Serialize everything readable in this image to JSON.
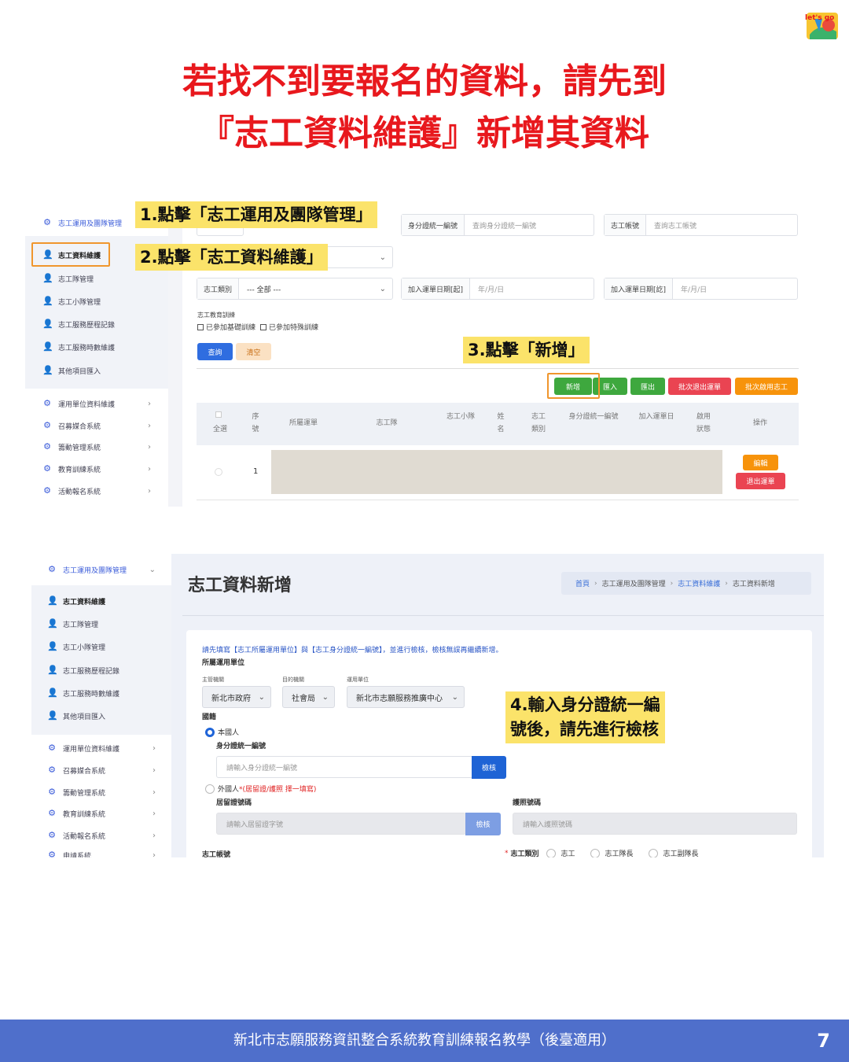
{
  "page": {
    "title_line1": "若找不到要報名的資料，請先到",
    "title_line2": "『志工資料維護』新增其資料",
    "footer_text": "新北市志願服務資訊整合系統教育訓練報名教學（後臺適用）",
    "page_number": "7",
    "logo_text": "let's go"
  },
  "colors": {
    "title": "#e8181d",
    "footer": "#4f6fcb",
    "callout": "#fbe36a",
    "highlight": "#f0962d"
  },
  "callouts": {
    "step1": "1.點擊「志工運用及團隊管理」",
    "step2": "2.點擊「志工資料維護」",
    "step3": "3.點擊「新增」",
    "step4_line1": "4.輸入身分證統一編",
    "step4_line2": "號後，請先進行檢核"
  },
  "shot1": {
    "sidebar": {
      "group": {
        "label": "志工運用及團隊管理",
        "icon": "gear-icon"
      },
      "subitems": [
        "志工資料維護",
        "志工隊管理",
        "志工小隊管理",
        "志工服務歷程記錄",
        "志工服務時數維護",
        "其他項目匯入"
      ],
      "modules": [
        "運用單位資料維護",
        "召募媒合系統",
        "籌動管理系統",
        "教育訓練系統",
        "活動報名系統"
      ]
    },
    "filters": {
      "id_label": "身分證統一編號",
      "id_placeholder": "查詢身分證統一編號",
      "account_label": "志工帳號",
      "account_placeholder": "查詢志工帳號",
      "type_label": "志工類別",
      "type_value": "--- 全部 ---",
      "join_start_label": "加入運單日期[起]",
      "join_start_placeholder": "年/月/日",
      "join_end_label": "加入運單日期[訖]",
      "join_end_placeholder": "年/月/日",
      "training_label": "志工教育訓練",
      "training_basic": "已參加基礎訓練",
      "training_special": "已參加特殊訓練"
    },
    "buttons": {
      "query": "查詢",
      "clear": "清空",
      "add": "新增",
      "import": "匯入",
      "export": "匯出",
      "batch_quit": "批次退出運單",
      "batch_enable": "批次啟用志工"
    },
    "table": {
      "headers": [
        "全選",
        "序號",
        "所屬運單",
        "志工隊",
        "志工小隊",
        "姓名",
        "志工類別",
        "身分證統一編號",
        "加入運單日",
        "啟用狀態",
        "操作"
      ],
      "rows": [
        {
          "seq": "1",
          "edit": "編輯",
          "quit": "退出運單"
        }
      ]
    }
  },
  "shot2": {
    "sidebar": {
      "group": "志工運用及團隊管理",
      "subitems": [
        "志工資料維護",
        "志工隊管理",
        "志工小隊管理",
        "志工服務歷程記錄",
        "志工服務時數維護",
        "其他項目匯入"
      ],
      "modules": [
        "運用單位資料維護",
        "召募媒合系統",
        "籌動管理系統",
        "教育訓練系統",
        "活動報名系統",
        "申請系統"
      ]
    },
    "header": {
      "title": "志工資料新增",
      "breadcrumb": [
        "首頁",
        "志工運用及團隊管理",
        "志工資料維護",
        "志工資料新增"
      ]
    },
    "form": {
      "notice": "請先填寫【志工所屬運用單位】與【志工身分證統一編號】，並進行檢核，檢核無誤再繼續新增。",
      "unit_section": "所屬運用單位",
      "authority_label": "主管機關",
      "authority_value": "新北市政府",
      "agency_label": "目的機關",
      "agency_value": "社會局",
      "unit_label": "運用單位",
      "unit_value": "新北市志願服務推廣中心",
      "nationality_label": "國籍",
      "citizen_label": "本國人",
      "id_label": "身分證統一編號",
      "id_placeholder": "請輸入身分證統一編號",
      "check_button": "檢核",
      "foreigner_label": "外國人",
      "foreigner_note": "*(居留證/護照 擇一填寫)",
      "residence_label": "居留證號碼",
      "residence_placeholder": "請輸入居留證字號",
      "residence_check": "檢核",
      "passport_label": "護照號碼",
      "passport_placeholder": "請輸入護照號碼",
      "account_label": "志工帳號",
      "category_label": "志工類別",
      "category_required": "*",
      "category_options": [
        "志工",
        "志工隊長",
        "志工副隊長"
      ]
    }
  }
}
